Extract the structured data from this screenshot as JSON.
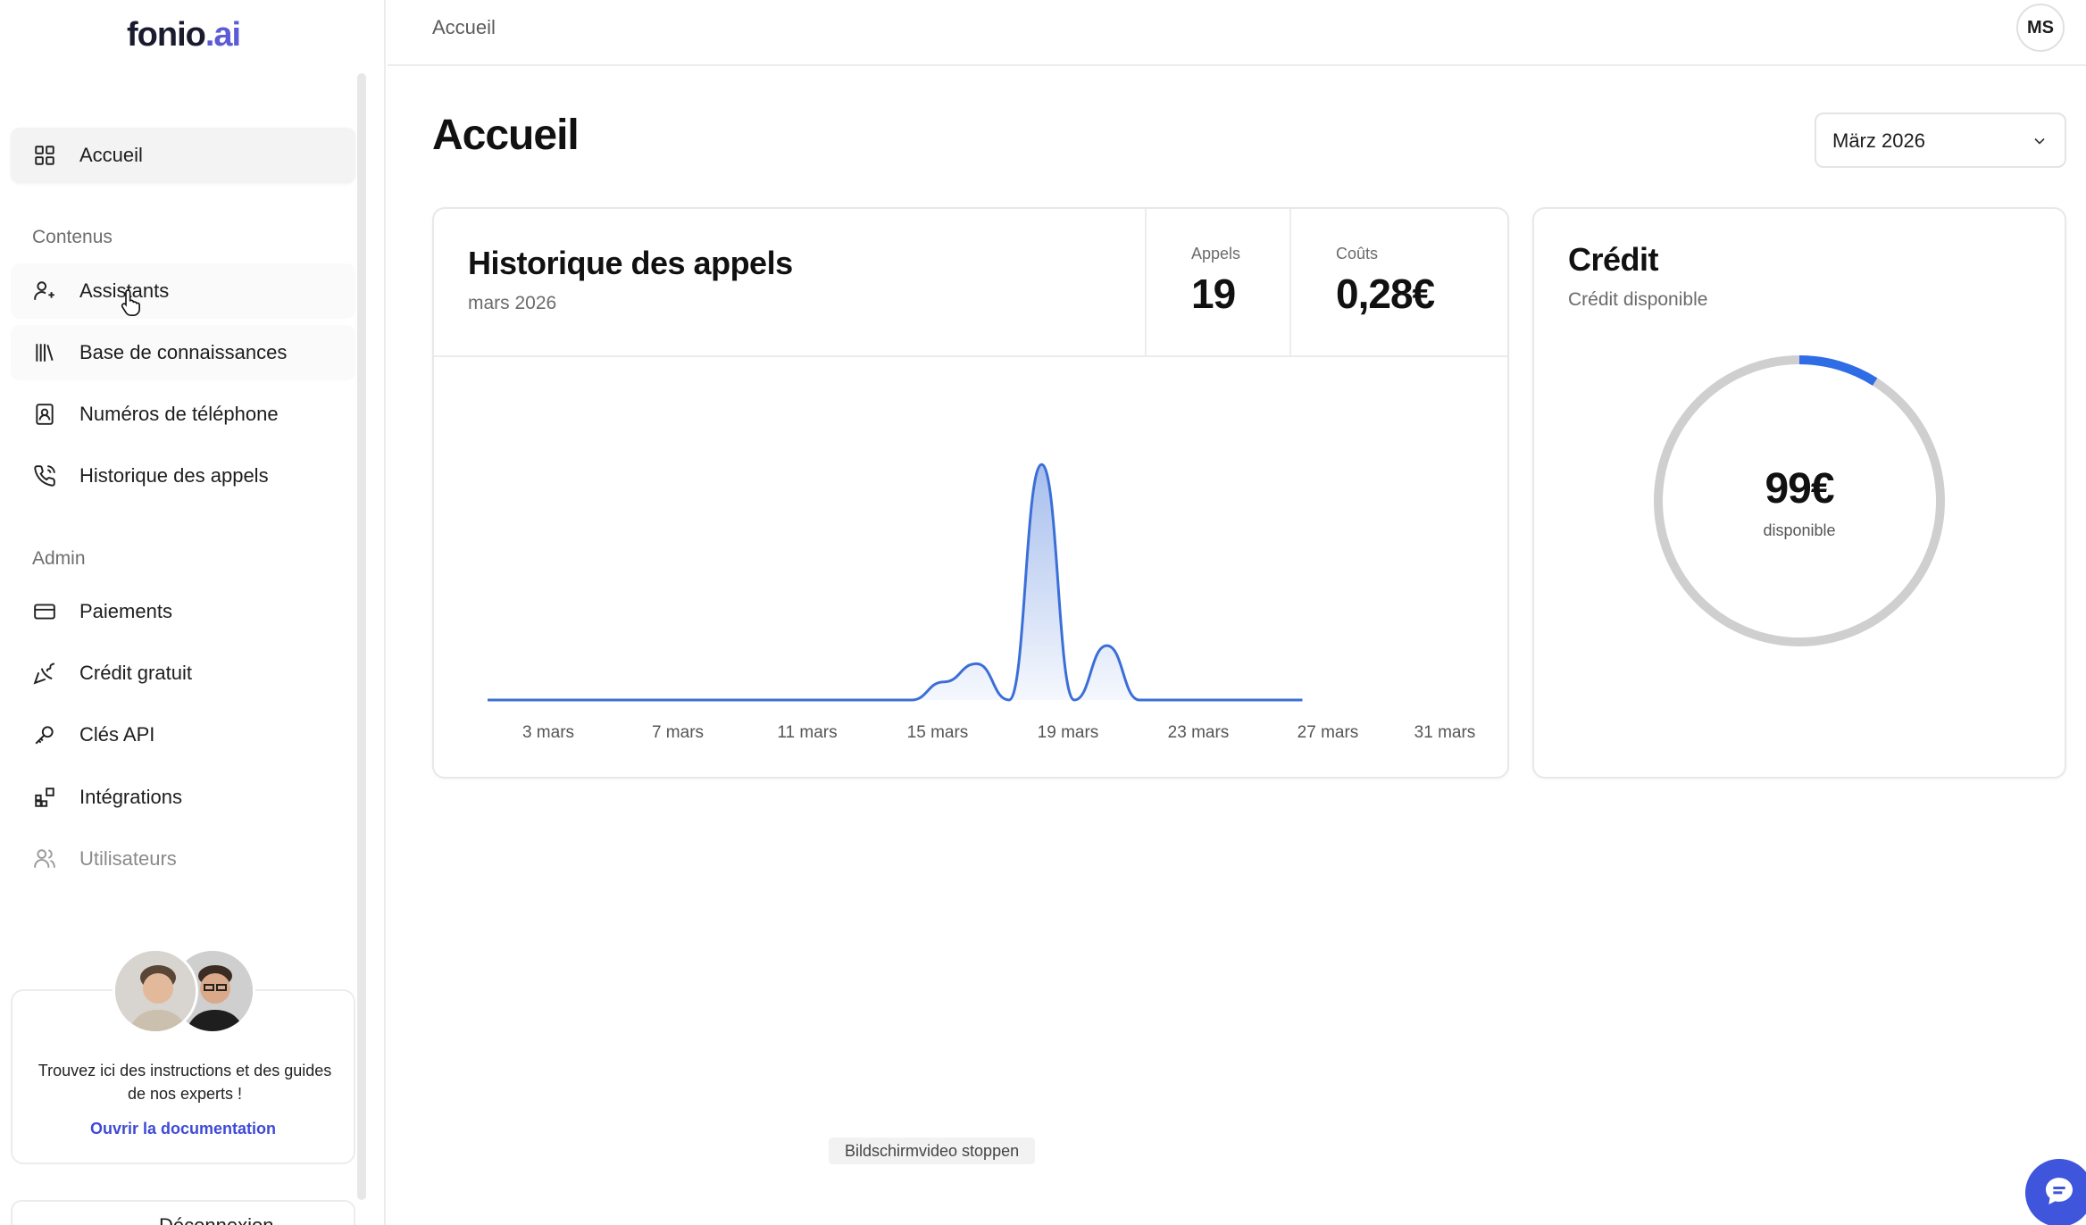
{
  "brand": {
    "name_main": "fonio",
    "name_suffix": ".ai"
  },
  "sidebar": {
    "home": {
      "label": "Accueil",
      "icon": "grid-icon"
    },
    "section_content": "Contenus",
    "content_items": [
      {
        "label": "Assistants",
        "icon": "user-bot-icon"
      },
      {
        "label": "Base de connaissances",
        "icon": "library-icon"
      },
      {
        "label": "Numéros de téléphone",
        "icon": "contact-book-icon"
      },
      {
        "label": "Historique des appels",
        "icon": "phone-call-icon"
      }
    ],
    "section_admin": "Admin",
    "admin_items": [
      {
        "label": "Paiements",
        "icon": "credit-card-icon"
      },
      {
        "label": "Crédit gratuit",
        "icon": "party-popper-icon"
      },
      {
        "label": "Clés API",
        "icon": "key-icon"
      },
      {
        "label": "Intégrations",
        "icon": "blocks-icon"
      },
      {
        "label": "Utilisateurs",
        "icon": "users-icon"
      }
    ],
    "doc_card": {
      "text": "Trouvez ici des instructions et des guides de nos experts !",
      "link": "Ouvrir la documentation"
    },
    "logout_label": "Déconnexion"
  },
  "topbar": {
    "breadcrumb": "Accueil",
    "user_initials": "MS"
  },
  "page": {
    "title": "Accueil",
    "month_select": "März 2026"
  },
  "calls_card": {
    "title": "Historique des appels",
    "subtitle": "mars 2026",
    "stats": {
      "calls_label": "Appels",
      "calls_value": "19",
      "costs_label": "Coûts",
      "costs_value": "0,28€"
    }
  },
  "chart_data": {
    "type": "area",
    "title": "Historique des appels",
    "x_ticks": [
      "3 mars",
      "7 mars",
      "11 mars",
      "15 mars",
      "19 mars",
      "23 mars",
      "27 mars",
      "31 mars"
    ],
    "x": [
      1,
      2,
      3,
      4,
      5,
      6,
      7,
      8,
      9,
      10,
      11,
      12,
      13,
      14,
      15,
      16,
      17,
      18,
      19,
      20,
      21,
      22,
      23,
      24,
      25,
      26
    ],
    "values": [
      0,
      0,
      0,
      0,
      0,
      0,
      0,
      0,
      0,
      0,
      0,
      0,
      0,
      0,
      1,
      2,
      0,
      13,
      0,
      3,
      0,
      0,
      0,
      0,
      0,
      0
    ],
    "ylim": [
      0,
      14
    ],
    "grid": false,
    "color": "#3b6fd8"
  },
  "credit_card": {
    "title": "Crédit",
    "subtitle": "Crédit disponible",
    "value": "99€",
    "value_label": "disponible",
    "used_fraction": 0.09,
    "ring_color": "#cfcfcf",
    "accent_color": "#2f6de6"
  },
  "overlay": {
    "recording_pill": "Bildschirmvideo stoppen"
  }
}
